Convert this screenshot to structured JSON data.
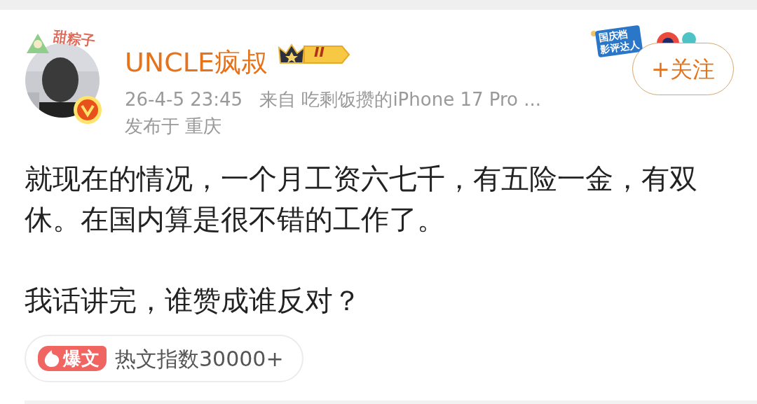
{
  "author": {
    "name": "UNCLE疯叔",
    "avatar_frame_text": "甜粽子",
    "level": "II",
    "verified": true,
    "time": "26-4-5 23:45",
    "source": "来自 吃剩饭攒的iPhone 17 Pro ...",
    "location": "发布于 重庆"
  },
  "achievement_badge": {
    "lines": [
      "国庆档",
      "影评达人"
    ]
  },
  "follow_button": {
    "label": "+关注"
  },
  "post": {
    "paragraphs": [
      "就现在的情况，一个月工资六七千，有五险一金，有双休。在国内算是很不错的工作了。",
      "我话讲完，谁赞成谁反对？"
    ]
  },
  "hot_tag": {
    "tag": "爆文",
    "text": "热文指数30000+"
  }
}
